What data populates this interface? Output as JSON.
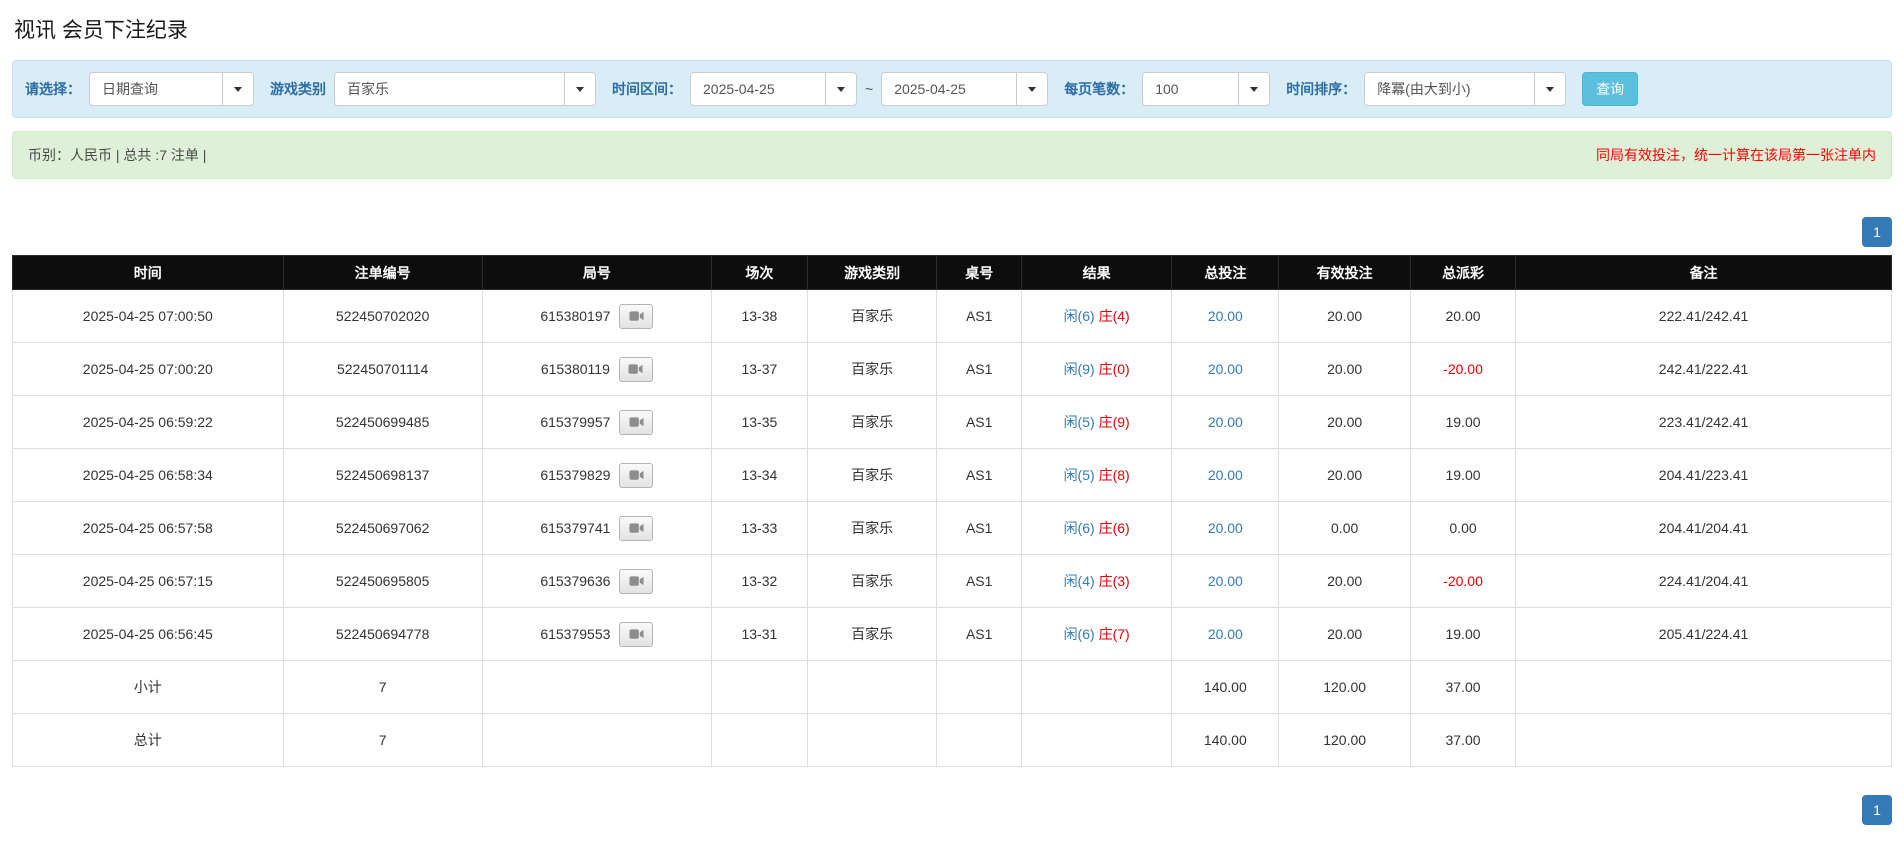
{
  "page": {
    "title": "视讯 会员下注纪录"
  },
  "filters": {
    "select_label": "请选择：",
    "select_value": "日期查询",
    "game_type_label": "游戏类别",
    "game_type_value": "百家乐",
    "time_range_label": "时间区间：",
    "time_from": "2025-04-25",
    "tilde": "~",
    "time_to": "2025-04-25",
    "page_size_label": "每页笔数：",
    "page_size_value": "100",
    "sort_label": "时间排序：",
    "sort_value": "降冪(由大到小)",
    "search_button": "查询"
  },
  "summary": {
    "left": "币别：人民币 | 总共 :7 注单 |",
    "right": "同局有效投注，统一计算在该局第一张注单内"
  },
  "pagination": {
    "page": "1"
  },
  "icons": {
    "dropdown_caret": "caret-down",
    "video_replay": "video-camera"
  },
  "table": {
    "headers": [
      "时间",
      "注单编号",
      "局号",
      "场次",
      "游戏类别",
      "桌号",
      "结果",
      "总投注",
      "有效投注",
      "总派彩",
      "备注"
    ],
    "rows": [
      {
        "time": "2025-04-25 07:00:50",
        "bet_id": "522450702020",
        "round_id": "615380197",
        "session": "13-38",
        "game": "百家乐",
        "table_no": "AS1",
        "result_player": "闲(6)",
        "result_banker": "庄(4)",
        "total_bet": "20.00",
        "valid_bet": "20.00",
        "payout": "20.00",
        "note": "222.41/242.41",
        "highlight": false
      },
      {
        "time": "2025-04-25 07:00:20",
        "bet_id": "522450701114",
        "round_id": "615380119",
        "session": "13-37",
        "game": "百家乐",
        "table_no": "AS1",
        "result_player": "闲(9)",
        "result_banker": "庄(0)",
        "total_bet": "20.00",
        "valid_bet": "20.00",
        "payout": "-20.00",
        "note": "242.41/222.41",
        "highlight": false
      },
      {
        "time": "2025-04-25 06:59:22",
        "bet_id": "522450699485",
        "round_id": "615379957",
        "session": "13-35",
        "game": "百家乐",
        "table_no": "AS1",
        "result_player": "闲(5)",
        "result_banker": "庄(9)",
        "total_bet": "20.00",
        "valid_bet": "20.00",
        "payout": "19.00",
        "note": "223.41/242.41",
        "highlight": false
      },
      {
        "time": "2025-04-25 06:58:34",
        "bet_id": "522450698137",
        "round_id": "615379829",
        "session": "13-34",
        "game": "百家乐",
        "table_no": "AS1",
        "result_player": "闲(5)",
        "result_banker": "庄(8)",
        "total_bet": "20.00",
        "valid_bet": "20.00",
        "payout": "19.00",
        "note": "204.41/223.41",
        "highlight": false
      },
      {
        "time": "2025-04-25 06:57:58",
        "bet_id": "522450697062",
        "round_id": "615379741",
        "session": "13-33",
        "game": "百家乐",
        "table_no": "AS1",
        "result_player": "闲(6)",
        "result_banker": "庄(6)",
        "total_bet": "20.00",
        "valid_bet": "0.00",
        "payout": "0.00",
        "note": "204.41/204.41",
        "highlight": false
      },
      {
        "time": "2025-04-25 06:57:15",
        "bet_id": "522450695805",
        "round_id": "615379636",
        "session": "13-32",
        "game": "百家乐",
        "table_no": "AS1",
        "result_player": "闲(4)",
        "result_banker": "庄(3)",
        "total_bet": "20.00",
        "valid_bet": "20.00",
        "payout": "-20.00",
        "note": "224.41/204.41",
        "highlight": false
      },
      {
        "time": "2025-04-25 06:56:45",
        "bet_id": "522450694778",
        "round_id": "615379553",
        "session": "13-31",
        "game": "百家乐",
        "table_no": "AS1",
        "result_player": "闲(6)",
        "result_banker": "庄(7)",
        "total_bet": "20.00",
        "valid_bet": "20.00",
        "payout": "19.00",
        "note": "205.41/224.41",
        "highlight": true
      }
    ],
    "subtotal": {
      "label": "小计",
      "count": "7",
      "total_bet": "140.00",
      "valid_bet": "120.00",
      "payout": "37.00"
    },
    "total": {
      "label": "总计",
      "count": "7",
      "total_bet": "140.00",
      "valid_bet": "120.00",
      "payout": "37.00"
    }
  }
}
